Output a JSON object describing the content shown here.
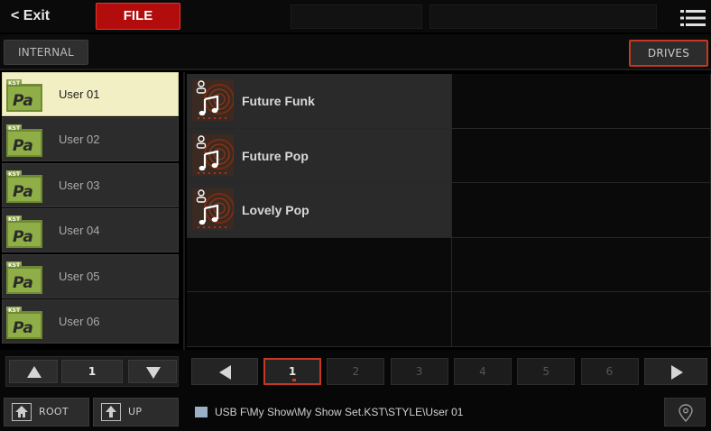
{
  "topbar": {
    "exit_label": "< Exit",
    "file_tab_label": "FILE"
  },
  "header": {
    "internal_label": "INTERNAL",
    "drives_label": "DRIVES"
  },
  "folders": [
    {
      "badge": "KST",
      "logo": "Pa",
      "label": "User 01",
      "selected": true
    },
    {
      "badge": "KST",
      "logo": "Pa",
      "label": "User 02",
      "selected": false
    },
    {
      "badge": "KST",
      "logo": "Pa",
      "label": "User 03",
      "selected": false
    },
    {
      "badge": "KST",
      "logo": "Pa",
      "label": "User 04",
      "selected": false
    },
    {
      "badge": "KST",
      "logo": "Pa",
      "label": "User 05",
      "selected": false
    },
    {
      "badge": "KST",
      "logo": "Pa",
      "label": "User 06",
      "selected": false
    }
  ],
  "files": [
    {
      "name": "Future Funk",
      "icon": "user-style-icon"
    },
    {
      "name": "Future Pop",
      "icon": "user-style-icon"
    },
    {
      "name": "Lovely Pop",
      "icon": "user-style-icon"
    }
  ],
  "left_pager": {
    "page": "1"
  },
  "pager": {
    "pages": [
      "1",
      "2",
      "3",
      "4",
      "5",
      "6"
    ],
    "active_page": "1"
  },
  "bottom": {
    "root_label": "ROOT",
    "up_label": "UP",
    "path": "USB F\\My Show\\My Show Set.KST\\STYLE\\User 01"
  },
  "colors": {
    "accent_red": "#c53a1e",
    "file_tab": "#b30c0c",
    "selected_item": "#f3efc4"
  }
}
